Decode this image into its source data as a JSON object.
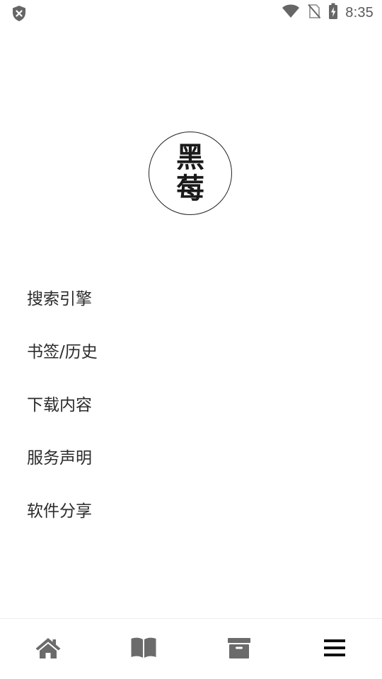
{
  "status_bar": {
    "time": "8:35",
    "icons": [
      "shield-x-icon",
      "wifi-icon",
      "no-sim-icon",
      "battery-charging-icon"
    ]
  },
  "logo": {
    "line1": "黑",
    "line2": "莓"
  },
  "menu": {
    "items": [
      {
        "label": "搜索引擎"
      },
      {
        "label": "书签/历史"
      },
      {
        "label": "下载内容"
      },
      {
        "label": "服务声明"
      },
      {
        "label": "软件分享"
      }
    ]
  },
  "bottom_nav": {
    "items": [
      {
        "icon": "home-icon"
      },
      {
        "icon": "book-icon"
      },
      {
        "icon": "archive-icon"
      },
      {
        "icon": "menu-icon",
        "active": true
      }
    ]
  },
  "colors": {
    "icon_gray": "#6b6b6b",
    "active": "#111111",
    "text": "#2b2b2b"
  }
}
